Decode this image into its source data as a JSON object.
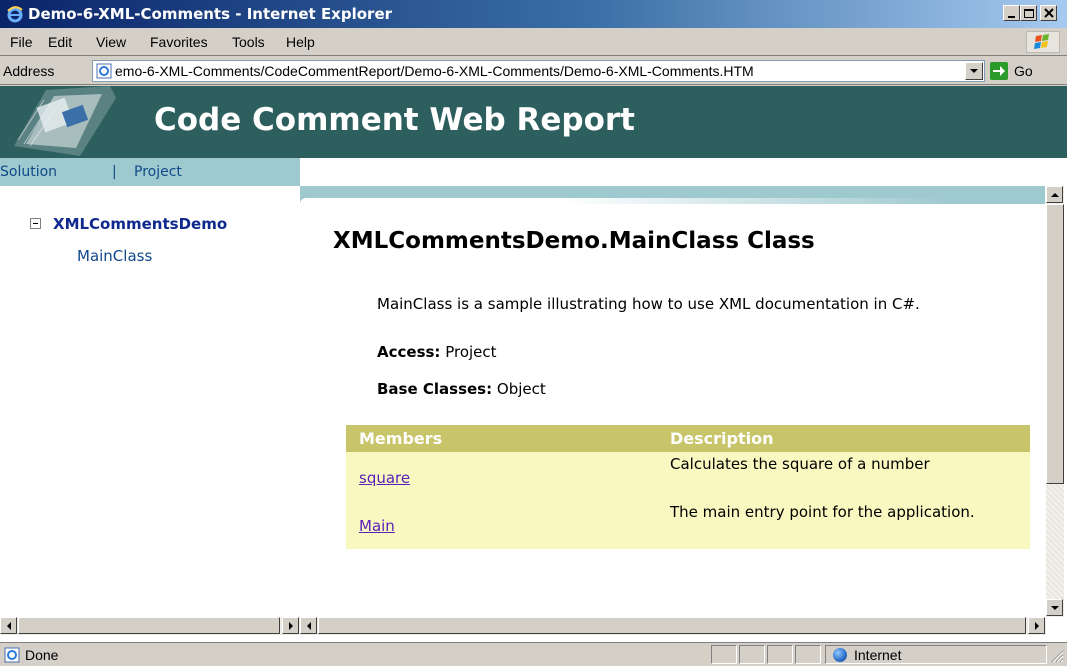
{
  "window": {
    "title": "Demo-6-XML-Comments - Internet Explorer",
    "controls": [
      "minimize-icon",
      "maximize-icon",
      "close-icon"
    ]
  },
  "menu": [
    "File",
    "Edit",
    "View",
    "Favorites",
    "Tools",
    "Help"
  ],
  "address": {
    "label": "Address",
    "url": "emo-6-XML-Comments/CodeCommentReport/Demo-6-XML-Comments/Demo-6-XML-Comments.HTM",
    "go_label": "Go"
  },
  "report": {
    "header_title": "Code Comment Web Report",
    "nav_tabs": [
      "Solution",
      "Project"
    ],
    "nav_separator": "|",
    "tree": {
      "root": "XMLCommentsDemo",
      "child": "MainClass"
    },
    "class_title": "XMLCommentsDemo.MainClass Class",
    "summary": "MainClass is a sample illustrating how to use XML documentation in C#.",
    "access_label": "Access:",
    "access_value": "Project",
    "base_label": "Base Classes:",
    "base_value": "Object",
    "members_table": {
      "headers": [
        "Members",
        "Description"
      ],
      "rows": [
        {
          "member": "square",
          "description": "Calculates the square of a number"
        },
        {
          "member": "Main",
          "description": "The main entry point for the application."
        }
      ]
    }
  },
  "status": {
    "text": "Done",
    "zone": "Internet"
  },
  "colors": {
    "header_bg": "#2e5f5f",
    "nav_tab_bg": "#9ec9cf",
    "table_header_bg": "#c8c46a",
    "table_body_bg": "#f9f8c1",
    "link": "#5a22b8"
  }
}
